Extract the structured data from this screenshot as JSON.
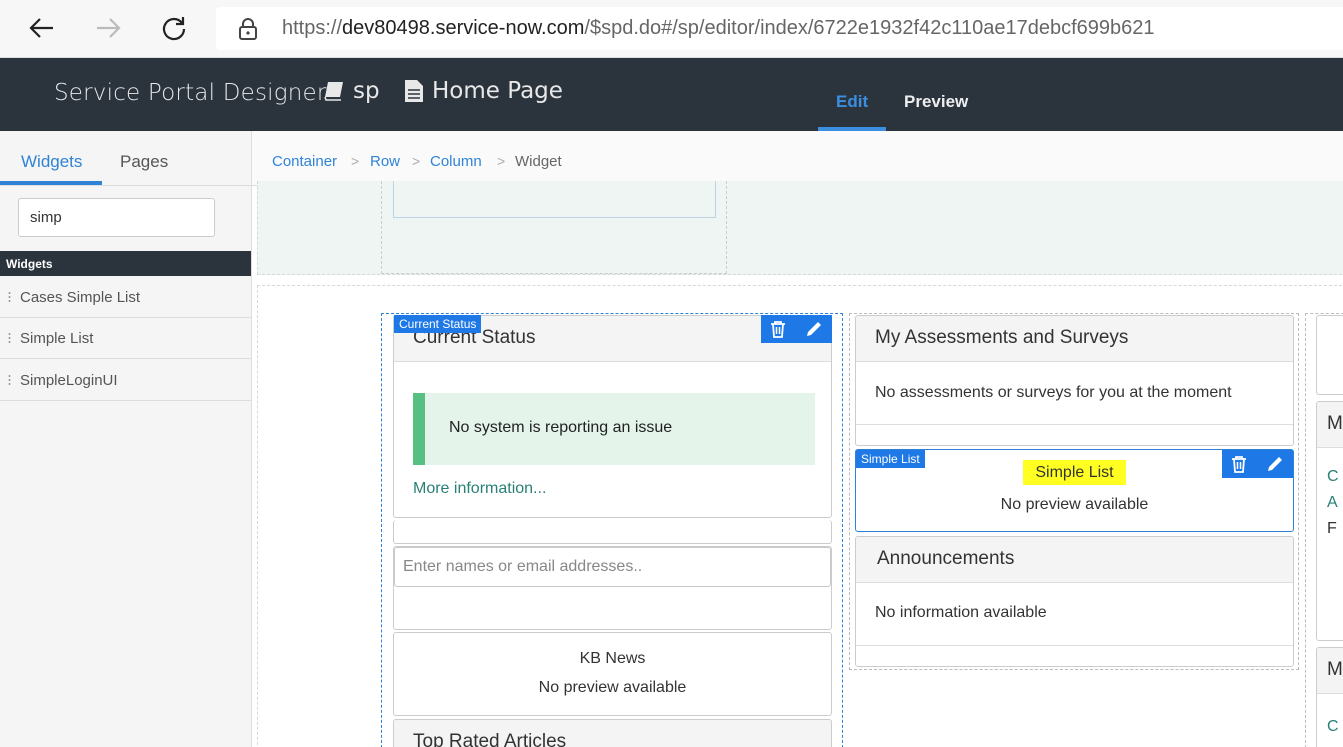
{
  "browser": {
    "url_prefix": "https://",
    "url_host": "dev80498.service-now.com",
    "url_path": "/$spd.do#/sp/editor/index/6722e1932f42c110ae17debcf699b621"
  },
  "header": {
    "title": "Service Portal Designer",
    "portal": "sp",
    "page": "Home Page",
    "tabs": {
      "edit": "Edit",
      "preview": "Preview"
    }
  },
  "sidebar": {
    "tabs": {
      "widgets": "Widgets",
      "pages": "Pages"
    },
    "search_value": "simp",
    "section_title": "Widgets",
    "items": [
      "Cases Simple List",
      "Simple List",
      "SimpleLoginUI"
    ]
  },
  "breadcrumb": [
    "Container",
    "Row",
    "Column",
    "Widget"
  ],
  "canvas": {
    "current_status": {
      "label": "Current Status",
      "title": "Current Status",
      "status_text": "No system is reporting an issue",
      "more_link": "More information..."
    },
    "people_input": {
      "placeholder": "Enter names or email addresses.."
    },
    "kb_news": {
      "title": "KB News",
      "subtitle": "No preview available"
    },
    "top_rated": {
      "title": "Top Rated Articles"
    },
    "assessments": {
      "title": "My Assessments and Surveys",
      "body": "No assessments or surveys for you at the moment"
    },
    "simple_list": {
      "label": "Simple List",
      "title": "Simple List",
      "subtitle": "No preview available"
    },
    "announcements": {
      "title": "Announcements",
      "body": "No information available"
    },
    "right_cut": {
      "heading1": "M",
      "heading2": "M",
      "c1": "C",
      "c2": "A",
      "c3": "F",
      "c4": "C"
    }
  },
  "colors": {
    "header_bg": "#2b333d",
    "accent": "#1e78e6",
    "status_green": "#55c082",
    "highlight": "#ffff22"
  }
}
